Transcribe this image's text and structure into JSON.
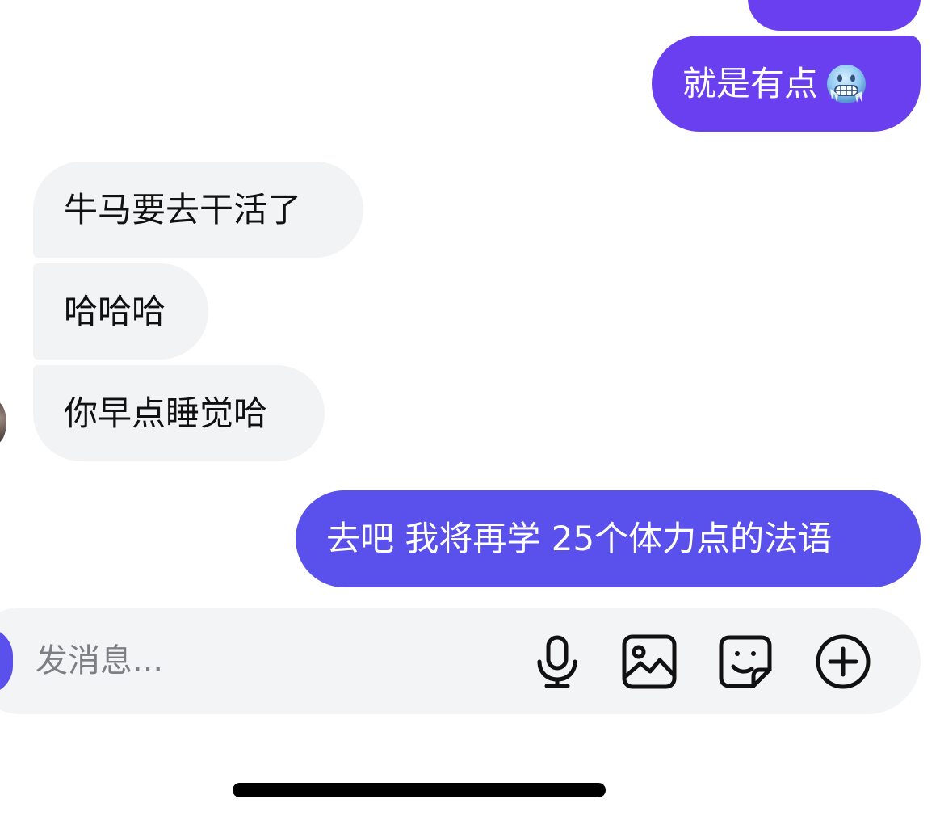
{
  "theme": {
    "outgoing_bubble_color": "#6a3ff0",
    "outgoing_bubble_color_alt": "#5a50ec",
    "incoming_bubble_color": "#f2f3f5",
    "composer_background": "#f3f4f6"
  },
  "messages": [
    {
      "direction": "outgoing",
      "text": ""
    },
    {
      "direction": "outgoing",
      "text": "就是有点",
      "emoji": "freezing-face-icon"
    },
    {
      "direction": "incoming",
      "text": "牛马要去干活了"
    },
    {
      "direction": "incoming",
      "text": "哈哈哈"
    },
    {
      "direction": "incoming",
      "text": "你早点睡觉哈"
    },
    {
      "direction": "outgoing",
      "text": "去吧 我将再学 25个体力点的法语"
    }
  ],
  "composer": {
    "placeholder": "发消息...",
    "tools": [
      "microphone-icon",
      "image-icon",
      "sticker-icon",
      "plus-circle-icon"
    ]
  }
}
